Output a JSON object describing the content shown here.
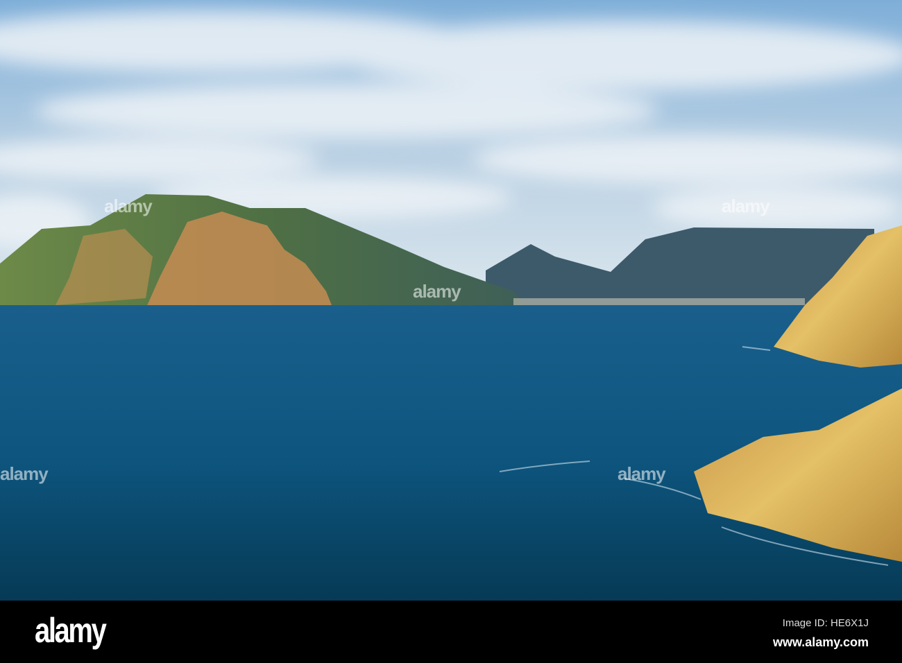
{
  "photo": {
    "colors": {
      "sky_top": "#8fb8dc",
      "sky_low": "#d9e6ef",
      "sea": "#0d5a86",
      "sea_deep": "#06344f",
      "cliff": "#d9a845"
    }
  },
  "watermark": {
    "text": "alamy"
  },
  "footer": {
    "logo": "alamy",
    "image_id": "Image ID: HE6X1J",
    "site": "www.alamy.com"
  }
}
